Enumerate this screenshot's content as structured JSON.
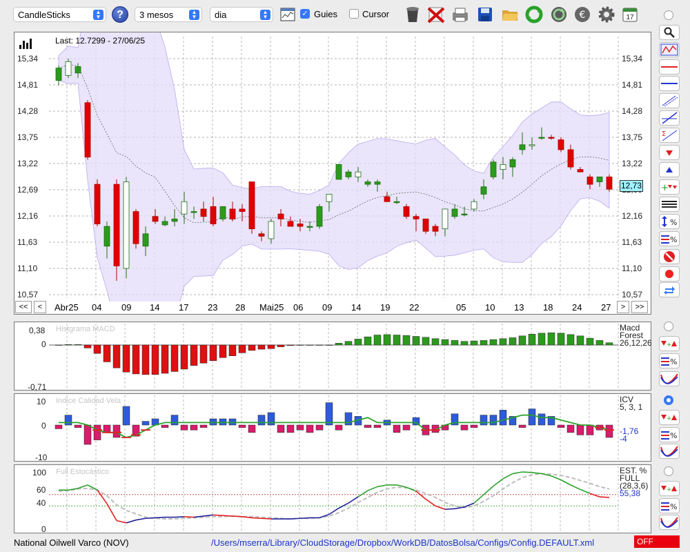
{
  "toolbar": {
    "instrument_select": "CandleSticks",
    "period_select": "3 mesos",
    "interval_select": "dia",
    "guides_label": "Guies",
    "guides_checked": true,
    "cursor_label": "Cursor",
    "cursor_checked": false,
    "calendar_day": "17"
  },
  "main_chart": {
    "last_label": "Last: 12.7299 - 27/06/25",
    "price_ticks": [
      "15,34",
      "14,81",
      "14,28",
      "13,75",
      "13,22",
      "12,69",
      "12,16",
      "11,63",
      "11,10",
      "10,57"
    ],
    "current_price": "12,73",
    "date_labels": [
      "Abr25",
      "04",
      "09",
      "14",
      "17",
      "23",
      "28",
      "Mai25",
      "06",
      "09",
      "14",
      "19",
      "22",
      "05",
      "10",
      "13",
      "18",
      "24",
      "27"
    ],
    "nav_first": "<<",
    "nav_prev": "<",
    "nav_next": ">",
    "nav_last": ">>"
  },
  "macd_panel": {
    "title": "Histgrama MACD",
    "top_tick": "0,38",
    "zero_tick": "0",
    "bottom_tick": "-0,71",
    "side_label_1": "Macd",
    "side_label_2": "Forest",
    "side_label_3": "26,12,26"
  },
  "icv_panel": {
    "title": "Indice Calidad Vela",
    "top_tick": "10",
    "zero_tick": "0",
    "bottom_tick": "-10",
    "side_label_1": "ICV",
    "side_label_2": "5, 3, 1",
    "value_1": "-1,76",
    "value_2": "-4"
  },
  "stoch_panel": {
    "title": "Full Estocástico",
    "ticks": [
      "100",
      "60",
      "40",
      "0"
    ],
    "side_label_1": "EST. %",
    "side_label_2": "FULL",
    "side_label_3": "(28,3,6)",
    "value": "55,38"
  },
  "status": {
    "instrument": "National Oilwell Varco (NOV)",
    "config_path": "/Users/mserra/Library/CloudStorage/Dropbox/WorkDB/DatosBolsa/Configs/Config.DEFAULT.xml",
    "off_label": "OFF"
  },
  "colors": {
    "bull": "#2c9a1c",
    "bear": "#e00000",
    "band_fill": "#e3dcf8",
    "macd_neg": "#dd1111",
    "macd_pos": "#2c9a1c",
    "icv_pos": "#2e5bd8",
    "icv_neg": "#d81b6a",
    "link": "#1a34c8"
  },
  "chart_data": [
    {
      "type": "candlestick",
      "title": "Last: 12.7299 - 27/06/25",
      "ylim": [
        10.57,
        15.34
      ],
      "candles": [
        {
          "o": 14.9,
          "h": 15.2,
          "l": 14.8,
          "c": 15.15
        },
        {
          "o": 15.0,
          "h": 15.34,
          "l": 14.95,
          "c": 15.28
        },
        {
          "o": 15.05,
          "h": 15.25,
          "l": 14.95,
          "c": 15.18
        },
        {
          "o": 14.45,
          "h": 14.5,
          "l": 13.3,
          "c": 13.35
        },
        {
          "o": 12.8,
          "h": 12.9,
          "l": 11.95,
          "c": 12.0
        },
        {
          "o": 11.55,
          "h": 12.05,
          "l": 11.3,
          "c": 11.95
        },
        {
          "o": 12.8,
          "h": 12.9,
          "l": 10.85,
          "c": 11.15
        },
        {
          "o": 11.1,
          "h": 12.95,
          "l": 10.9,
          "c": 12.85
        },
        {
          "o": 12.25,
          "h": 12.3,
          "l": 11.5,
          "c": 11.6
        },
        {
          "o": 11.55,
          "h": 11.95,
          "l": 11.35,
          "c": 11.8
        },
        {
          "o": 12.15,
          "h": 12.3,
          "l": 12.0,
          "c": 12.05
        },
        {
          "o": 11.98,
          "h": 12.15,
          "l": 11.95,
          "c": 12.05
        },
        {
          "o": 12.05,
          "h": 12.3,
          "l": 11.95,
          "c": 12.1
        },
        {
          "o": 12.2,
          "h": 12.65,
          "l": 12.0,
          "c": 12.45
        },
        {
          "o": 12.25,
          "h": 12.35,
          "l": 12.1,
          "c": 12.25
        },
        {
          "o": 12.3,
          "h": 12.45,
          "l": 12.05,
          "c": 12.15
        },
        {
          "o": 12.35,
          "h": 12.55,
          "l": 11.95,
          "c": 12.0
        },
        {
          "o": 12.1,
          "h": 12.35,
          "l": 12.05,
          "c": 12.35
        },
        {
          "o": 12.3,
          "h": 12.45,
          "l": 12.05,
          "c": 12.1
        },
        {
          "o": 12.3,
          "h": 12.4,
          "l": 12.05,
          "c": 12.25
        },
        {
          "o": 12.85,
          "h": 12.85,
          "l": 11.8,
          "c": 11.9
        },
        {
          "o": 11.8,
          "h": 11.85,
          "l": 11.65,
          "c": 11.75
        },
        {
          "o": 11.7,
          "h": 12.1,
          "l": 11.6,
          "c": 12.05
        },
        {
          "o": 12.2,
          "h": 12.3,
          "l": 11.95,
          "c": 12.1
        },
        {
          "o": 12.05,
          "h": 12.15,
          "l": 11.95,
          "c": 11.95
        },
        {
          "o": 12.0,
          "h": 12.1,
          "l": 11.85,
          "c": 11.95
        },
        {
          "o": 11.95,
          "h": 12.05,
          "l": 11.85,
          "c": 11.95
        },
        {
          "o": 11.95,
          "h": 12.4,
          "l": 11.9,
          "c": 12.35
        },
        {
          "o": 12.45,
          "h": 12.5,
          "l": 12.25,
          "c": 12.6
        },
        {
          "o": 12.9,
          "h": 13.2,
          "l": 12.9,
          "c": 13.2
        },
        {
          "o": 12.95,
          "h": 13.1,
          "l": 12.9,
          "c": 13.05
        },
        {
          "o": 12.95,
          "h": 13.15,
          "l": 12.85,
          "c": 13.05
        },
        {
          "o": 12.8,
          "h": 12.9,
          "l": 12.75,
          "c": 12.85
        },
        {
          "o": 12.8,
          "h": 12.9,
          "l": 12.65,
          "c": 12.85
        },
        {
          "o": 12.55,
          "h": 12.65,
          "l": 12.5,
          "c": 12.45
        },
        {
          "o": 12.45,
          "h": 12.55,
          "l": 12.4,
          "c": 12.45
        },
        {
          "o": 12.35,
          "h": 12.4,
          "l": 12.1,
          "c": 12.15
        },
        {
          "o": 12.15,
          "h": 12.2,
          "l": 11.85,
          "c": 12.1
        },
        {
          "o": 12.1,
          "h": 12.1,
          "l": 11.8,
          "c": 11.85
        },
        {
          "o": 11.95,
          "h": 12.0,
          "l": 11.75,
          "c": 11.85
        },
        {
          "o": 11.9,
          "h": 12.3,
          "l": 11.75,
          "c": 12.3
        },
        {
          "o": 12.15,
          "h": 12.4,
          "l": 12.1,
          "c": 12.3
        },
        {
          "o": 12.2,
          "h": 12.35,
          "l": 12.15,
          "c": 12.2
        },
        {
          "o": 12.3,
          "h": 12.5,
          "l": 12.25,
          "c": 12.45
        },
        {
          "o": 12.6,
          "h": 12.9,
          "l": 12.5,
          "c": 12.75
        },
        {
          "o": 12.95,
          "h": 13.3,
          "l": 12.9,
          "c": 13.25
        },
        {
          "o": 13.1,
          "h": 13.35,
          "l": 12.9,
          "c": 13.2
        },
        {
          "o": 13.15,
          "h": 13.35,
          "l": 12.95,
          "c": 13.3
        },
        {
          "o": 13.5,
          "h": 13.85,
          "l": 13.4,
          "c": 13.6
        },
        {
          "o": 13.6,
          "h": 13.75,
          "l": 13.5,
          "c": 13.6
        },
        {
          "o": 13.75,
          "h": 13.95,
          "l": 13.7,
          "c": 13.75
        },
        {
          "o": 13.75,
          "h": 13.8,
          "l": 13.7,
          "c": 13.73
        },
        {
          "o": 13.7,
          "h": 13.75,
          "l": 13.45,
          "c": 13.5
        },
        {
          "o": 13.5,
          "h": 13.6,
          "l": 13.1,
          "c": 13.15
        },
        {
          "o": 13.1,
          "h": 13.15,
          "l": 13.05,
          "c": 13.05
        },
        {
          "o": 12.95,
          "h": 13.0,
          "l": 12.7,
          "c": 12.8
        },
        {
          "o": 12.85,
          "h": 12.95,
          "l": 12.75,
          "c": 12.95
        },
        {
          "o": 12.95,
          "h": 13.0,
          "l": 12.65,
          "c": 12.7
        }
      ]
    },
    {
      "type": "bar",
      "title": "Histgrama MACD",
      "ylim": [
        -0.71,
        0.38
      ],
      "values": [
        0.0,
        0.01,
        0.01,
        -0.05,
        -0.14,
        -0.28,
        -0.38,
        -0.45,
        -0.48,
        -0.49,
        -0.49,
        -0.47,
        -0.44,
        -0.4,
        -0.34,
        -0.3,
        -0.26,
        -0.21,
        -0.18,
        -0.13,
        -0.09,
        -0.07,
        -0.06,
        -0.03,
        -0.01,
        0.0,
        0.0,
        0.0,
        0.0,
        0.04,
        0.08,
        0.13,
        0.18,
        0.22,
        0.23,
        0.22,
        0.21,
        0.19,
        0.17,
        0.14,
        0.12,
        0.1,
        0.08,
        0.09,
        0.1,
        0.12,
        0.14,
        0.16,
        0.2,
        0.24,
        0.26,
        0.27,
        0.26,
        0.23,
        0.2,
        0.15,
        0.1,
        0.05
      ]
    },
    {
      "type": "bar",
      "title": "Indice Calidad Vela",
      "ylim": [
        -10,
        10
      ],
      "values": [
        -1.5,
        4,
        -1,
        -7.8,
        -6,
        -3,
        -5,
        7.5,
        -4.5,
        1.5,
        2.5,
        -1,
        4,
        -2,
        -2,
        -1,
        2.5,
        2.5,
        2.5,
        -1,
        -3,
        4,
        5,
        -3,
        -3,
        -2,
        -3,
        -2,
        9,
        -2,
        5,
        3.5,
        -1,
        -1,
        2,
        -3,
        -2,
        3,
        -4,
        -3,
        -2,
        4.5,
        -2,
        -1,
        4,
        4,
        6,
        3.5,
        -1,
        6.5,
        4.5,
        3.5,
        -1,
        -3,
        -4,
        -4,
        -2,
        -5
      ],
      "line": [
        1,
        1,
        1,
        0,
        -2,
        -3,
        -3,
        -5,
        -4,
        -2,
        0,
        1,
        1,
        1,
        1,
        1,
        1,
        1,
        1,
        1,
        1,
        1,
        1,
        1,
        1,
        1,
        1,
        1,
        1,
        1,
        1,
        2,
        3,
        1,
        1,
        1,
        1,
        1,
        -2,
        -2,
        0,
        1,
        1,
        1,
        1,
        1,
        2,
        3,
        4,
        4,
        3,
        3,
        2,
        1,
        0,
        0,
        -1,
        -2
      ]
    },
    {
      "type": "line",
      "title": "Full Estocástico",
      "ylim": [
        0,
        100
      ],
      "series": [
        {
          "values": [
            68,
            68,
            71,
            77,
            68,
            44,
            14,
            10,
            15,
            18,
            19,
            20,
            20,
            21,
            20,
            22,
            24,
            23,
            22,
            21,
            19,
            18,
            17,
            17,
            17,
            18,
            19,
            19,
            25,
            36,
            45,
            56,
            67,
            74,
            77,
            77,
            73,
            66,
            52,
            40,
            34,
            35,
            38,
            45,
            60,
            75,
            88,
            97,
            100,
            99,
            97,
            93,
            86,
            77,
            69,
            62,
            56,
            55
          ]
        },
        {
          "values": [
            66,
            67,
            70,
            71,
            68,
            58,
            42,
            32,
            26,
            20,
            18,
            17,
            17,
            18,
            19,
            20,
            21,
            21,
            22,
            21,
            21,
            20,
            19,
            18,
            17,
            18,
            18,
            19,
            22,
            28,
            36,
            46,
            55,
            64,
            70,
            73,
            72,
            68,
            62,
            55,
            46,
            40,
            37,
            40,
            48,
            58,
            70,
            81,
            90,
            95,
            97,
            96,
            94,
            90,
            85,
            80,
            74,
            70
          ]
        }
      ]
    }
  ]
}
